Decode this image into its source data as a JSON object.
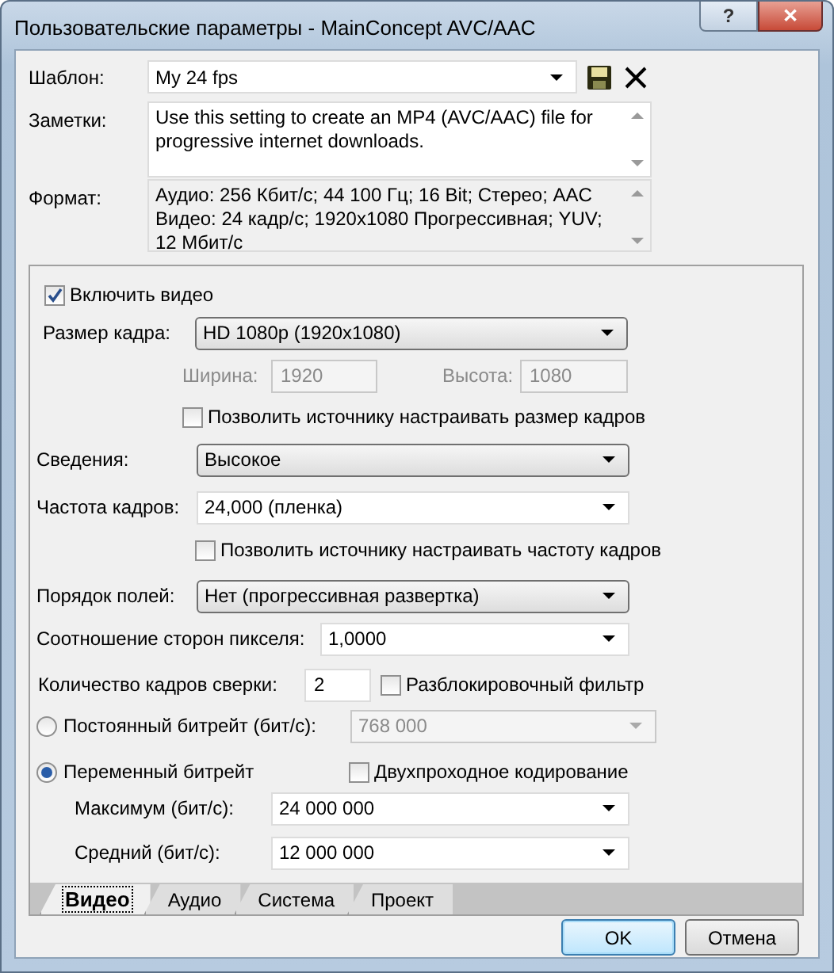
{
  "window": {
    "title": "Пользовательские параметры - MainConcept AVC/AAC",
    "help_button": "?",
    "close_button": "✕"
  },
  "template": {
    "label": "Шаблон:",
    "value": "My 24 fps"
  },
  "notes": {
    "label": "Заметки:",
    "value": "Use this setting to create an MP4 (AVC/AAC) file for progressive internet downloads."
  },
  "format": {
    "label": "Формат:",
    "lines": [
      "Аудио: 256 Кбит/с; 44 100 Гц; 16 Bit; Стерео; AAC",
      "Видео: 24 кадр/с; 1920x1080 Прогрессивная; YUV; 12 Мбит/с"
    ]
  },
  "video": {
    "enable_video": {
      "label": "Включить видео",
      "checked": true
    },
    "frame_size": {
      "label": "Размер кадра:",
      "value": "HD 1080p (1920x1080)"
    },
    "width": {
      "label": "Ширина:",
      "value": "1920",
      "disabled": true
    },
    "height": {
      "label": "Высота:",
      "value": "1080",
      "disabled": true
    },
    "allow_source_size": {
      "label": "Позволить источнику настраивать размер кадров",
      "checked": false
    },
    "profile": {
      "label": "Сведения:",
      "value": "Высокое"
    },
    "frame_rate": {
      "label": "Частота кадров:",
      "value": "24,000 (пленка)"
    },
    "allow_source_rate": {
      "label": "Позволить источнику настраивать частоту кадров",
      "checked": false
    },
    "field_order": {
      "label": "Порядок полей:",
      "value": "Нет (прогрессивная развертка)"
    },
    "pixel_aspect": {
      "label": "Соотношение сторон пикселя:",
      "value": "1,0000"
    },
    "reference_frames": {
      "label": "Количество кадров сверки:",
      "value": "2"
    },
    "deblocking": {
      "label": "Разблокировочный фильтр",
      "checked": false
    },
    "constant_bitrate": {
      "label": "Постоянный битрейт (бит/с):",
      "selected": false,
      "value": "768 000",
      "disabled": true
    },
    "variable_bitrate": {
      "label": "Переменный битрейт",
      "selected": true
    },
    "two_pass": {
      "label": "Двухпроходное кодирование",
      "checked": false
    },
    "maximum": {
      "label": "Максимум (бит/с):",
      "value": "24 000 000"
    },
    "average": {
      "label": "Средний (бит/с):",
      "value": "12 000 000"
    }
  },
  "tabs": [
    {
      "label": "Видео",
      "selected": true
    },
    {
      "label": "Аудио",
      "selected": false
    },
    {
      "label": "Система",
      "selected": false
    },
    {
      "label": "Проект",
      "selected": false
    }
  ],
  "buttons": [
    {
      "label": "OK",
      "default": true
    },
    {
      "label": "Отмена",
      "default": false
    }
  ]
}
